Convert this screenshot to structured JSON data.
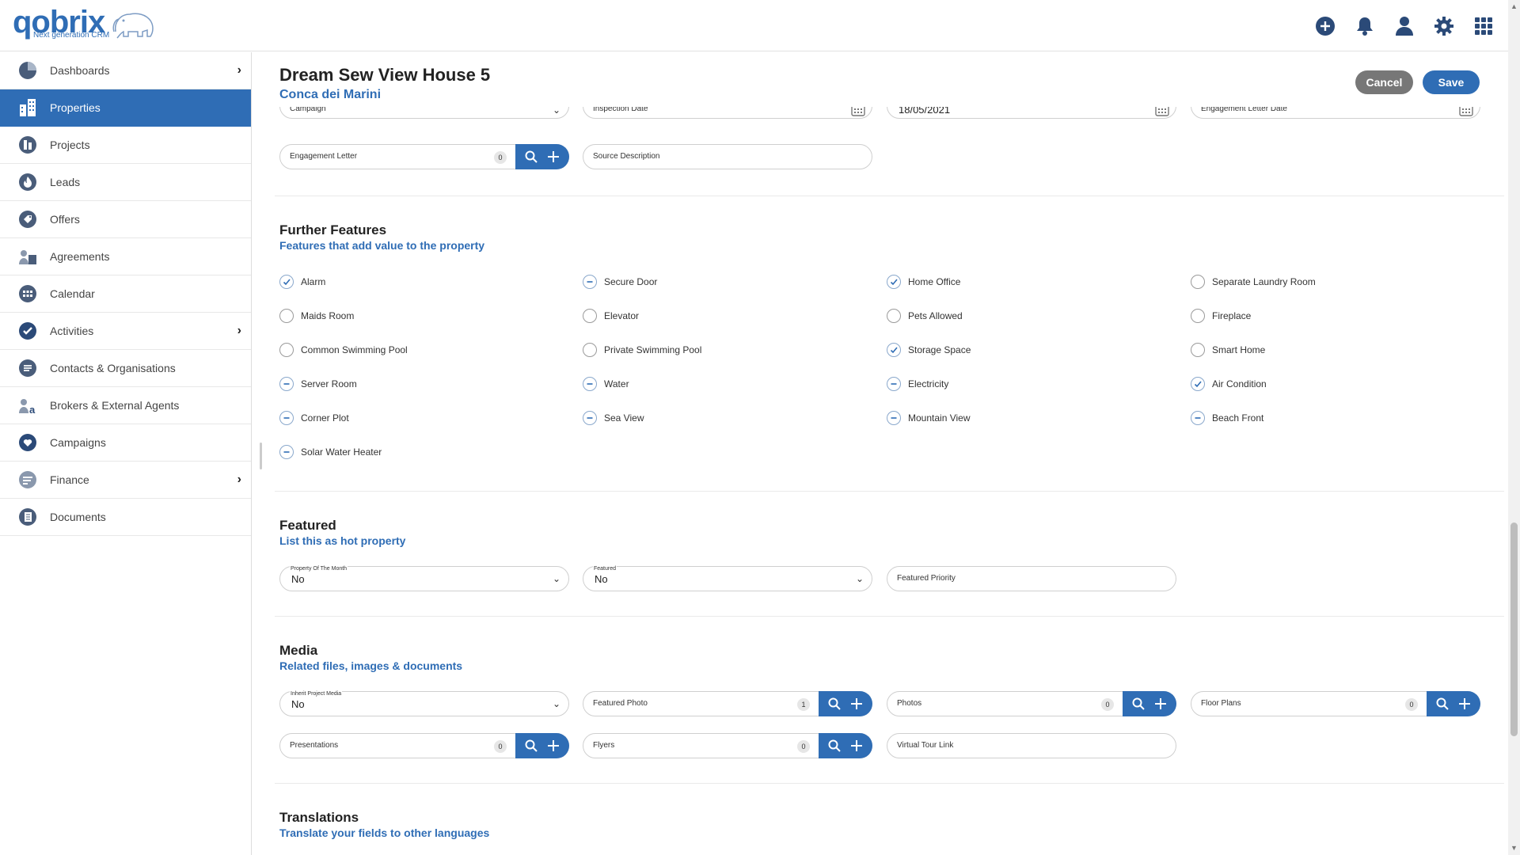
{
  "brand": {
    "name": "qobrix",
    "tagline": "Next generation CRM",
    "accent": "#2f6db5"
  },
  "topbar": {
    "icons": [
      "add-circle-icon",
      "bell-icon",
      "user-icon",
      "gear-icon",
      "apps-grid-icon"
    ]
  },
  "sidebar": {
    "items": [
      {
        "label": "Dashboards",
        "icon": "pie-chart-icon",
        "chevron": "›"
      },
      {
        "label": "Properties",
        "icon": "building-icon",
        "active": true
      },
      {
        "label": "Projects",
        "icon": "projects-icon"
      },
      {
        "label": "Leads",
        "icon": "flame-icon"
      },
      {
        "label": "Offers",
        "icon": "tag-icon"
      },
      {
        "label": "Agreements",
        "icon": "agreement-icon"
      },
      {
        "label": "Calendar",
        "icon": "calendar-icon"
      },
      {
        "label": "Activities",
        "icon": "check-icon",
        "chevron": "›"
      },
      {
        "label": "Contacts & Organisations",
        "icon": "chat-icon"
      },
      {
        "label": "Brokers & External Agents",
        "icon": "broker-icon"
      },
      {
        "label": "Campaigns",
        "icon": "heart-icon"
      },
      {
        "label": "Finance",
        "icon": "finance-icon",
        "chevron": "›"
      },
      {
        "label": "Documents",
        "icon": "documents-icon"
      }
    ]
  },
  "header": {
    "title": "Dream Sew View House 5",
    "subtitle": "Conca dei Marini",
    "cancel": "Cancel",
    "save": "Save"
  },
  "top_fields": {
    "campaign": "Campaign",
    "inspection_date": "Inspection Date",
    "date_value": "18/05/2021",
    "engagement_letter_date": "Engagement Letter Date",
    "engagement_letter": "Engagement Letter",
    "engagement_letter_count": "0",
    "source_description": "Source Description"
  },
  "further_features": {
    "title": "Further Features",
    "subtitle": "Features that add value to the property",
    "items": [
      {
        "label": "Alarm",
        "state": "checked"
      },
      {
        "label": "Secure Door",
        "state": "indeterminate"
      },
      {
        "label": "Home Office",
        "state": "checked"
      },
      {
        "label": "Separate Laundry Room",
        "state": "empty"
      },
      {
        "label": "Maids Room",
        "state": "empty"
      },
      {
        "label": "Elevator",
        "state": "empty"
      },
      {
        "label": "Pets Allowed",
        "state": "empty"
      },
      {
        "label": "Fireplace",
        "state": "empty"
      },
      {
        "label": "Common Swimming Pool",
        "state": "empty"
      },
      {
        "label": "Private Swimming Pool",
        "state": "empty"
      },
      {
        "label": "Storage Space",
        "state": "checked"
      },
      {
        "label": "Smart Home",
        "state": "empty"
      },
      {
        "label": "Server Room",
        "state": "indeterminate"
      },
      {
        "label": "Water",
        "state": "indeterminate"
      },
      {
        "label": "Electricity",
        "state": "indeterminate"
      },
      {
        "label": "Air Condition",
        "state": "checked"
      },
      {
        "label": "Corner Plot",
        "state": "indeterminate"
      },
      {
        "label": "Sea View",
        "state": "indeterminate"
      },
      {
        "label": "Mountain View",
        "state": "indeterminate"
      },
      {
        "label": "Beach Front",
        "state": "indeterminate"
      },
      {
        "label": "Solar Water Heater",
        "state": "indeterminate"
      }
    ]
  },
  "featured": {
    "title": "Featured",
    "subtitle": "List this as hot property",
    "property_of_month_label": "Property Of The Month",
    "property_of_month_value": "No",
    "featured_label": "Featured",
    "featured_value": "No",
    "featured_priority": "Featured Priority"
  },
  "media": {
    "title": "Media",
    "subtitle": "Related files, images & documents",
    "inherit_label": "Inherit Project Media",
    "inherit_value": "No",
    "featured_photo": "Featured Photo",
    "featured_photo_count": "1",
    "photos": "Photos",
    "photos_count": "0",
    "floor_plans": "Floor Plans",
    "floor_plans_count": "0",
    "presentations": "Presentations",
    "presentations_count": "0",
    "flyers": "Flyers",
    "flyers_count": "0",
    "virtual_tour": "Virtual Tour Link"
  },
  "translations": {
    "title": "Translations",
    "subtitle": "Translate your fields to other languages"
  }
}
